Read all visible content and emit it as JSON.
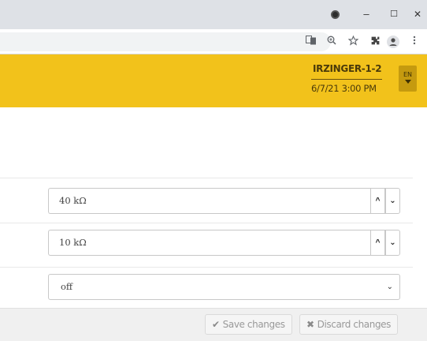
{
  "browser": {
    "window_controls": {
      "minimize": "–",
      "maximize": "☐",
      "close": "✕"
    },
    "toolbar_icons": [
      "translate-icon",
      "zoom-icon",
      "bookmark-star-icon",
      "extensions-icon",
      "profile-icon",
      "menu-icon"
    ]
  },
  "header": {
    "device_name": "IRZINGER-1-2",
    "datetime": "6/7/21 3:00 PM",
    "language": "EN",
    "background_color": "#f2c21b"
  },
  "form": {
    "fields": [
      {
        "value": "40 kΩ",
        "up": "^",
        "down": "⌄"
      },
      {
        "value": "10 kΩ",
        "up": "^",
        "down": "⌄"
      }
    ],
    "select": {
      "value": "off"
    }
  },
  "footer": {
    "save_label": "Save changes",
    "discard_label": "Discard changes"
  }
}
